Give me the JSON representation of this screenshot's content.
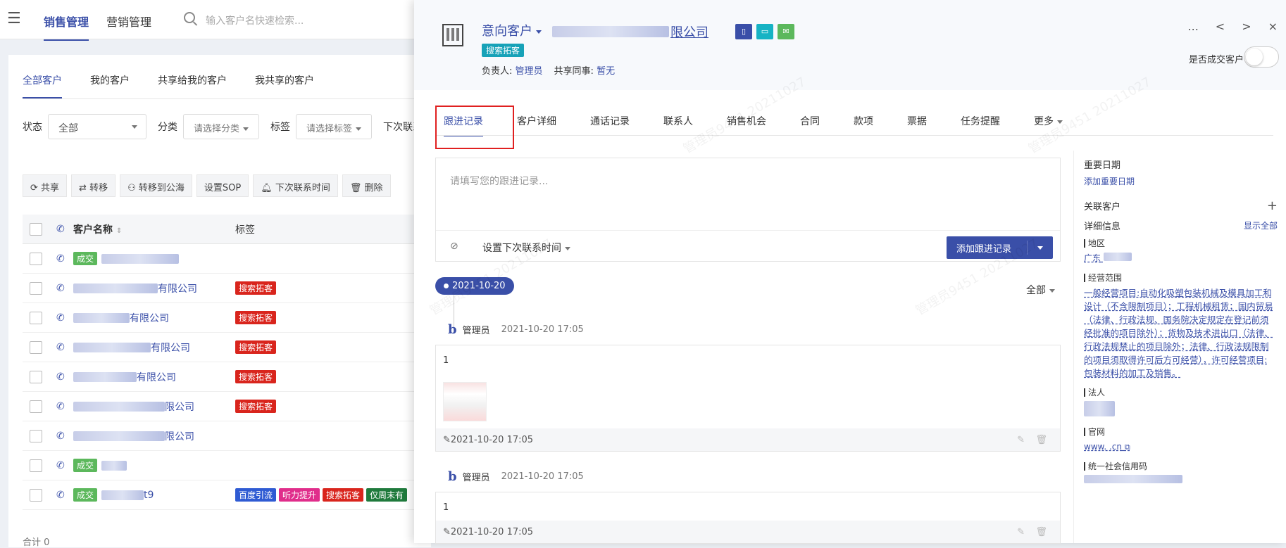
{
  "topbar": {
    "nav_sales": "销售管理",
    "nav_marketing": "营销管理",
    "search_placeholder": "输入客户名快速检索..."
  },
  "customer_tabs": [
    "全部客户",
    "我的客户",
    "共享给我的客户",
    "我共享的客户"
  ],
  "filters": {
    "status_label": "状态",
    "status_value": "全部",
    "category_label": "分类",
    "category_value": "请选择分类",
    "tag_label": "标签",
    "tag_value": "请选择标签",
    "next_contact_label": "下次联系"
  },
  "actions": [
    "共享",
    "转移",
    "转移到公海",
    "设置SOP",
    "下次联系时间",
    "删除"
  ],
  "table": {
    "headers": {
      "name": "客户名称",
      "tags": "标签"
    },
    "rows": [
      {
        "badge": "成交",
        "name_suffix": "",
        "tags": []
      },
      {
        "badge": "",
        "name_suffix": "有限公司",
        "tags": [
          "搜索拓客"
        ]
      },
      {
        "badge": "",
        "name_suffix": "有限公司",
        "tags": [
          "搜索拓客"
        ]
      },
      {
        "badge": "",
        "name_suffix": "有限公司",
        "tags": [
          "搜索拓客"
        ]
      },
      {
        "badge": "",
        "name_suffix": "有限公司",
        "tags": [
          "搜索拓客"
        ]
      },
      {
        "badge": "",
        "name_suffix": "限公司",
        "tags": [
          "搜索拓客"
        ]
      },
      {
        "badge": "",
        "name_suffix": "限公司",
        "tags": []
      },
      {
        "badge": "成交",
        "name_suffix": "",
        "tags": []
      },
      {
        "badge": "成交",
        "name_suffix": "t9",
        "tags": [
          "百度引流",
          "听力提升",
          "搜索拓客",
          "仅周末有"
        ]
      }
    ],
    "footer": "合计 0"
  },
  "tag_colors": {
    "搜索拓客": "#d9251d",
    "百度引流": "#2f5bd3",
    "听力提升": "#e02d8b",
    "仅周末有": "#1f7a3c",
    "成交": "#5cb85c"
  },
  "detail": {
    "status": "意向客户",
    "company_suffix": "限公司",
    "source_tag": "搜索拓客",
    "owner_label": "负责人:",
    "owner_value": "管理员",
    "share_label": "共享同事:",
    "share_value": "暂无",
    "header_controls": [
      "...",
      "<",
      ">",
      "×"
    ],
    "deal_label": "是否成交客户",
    "deal_toggle_on": false,
    "tabs": [
      "跟进记录",
      "客户详细",
      "通话记录",
      "联系人",
      "销售机会",
      "合同",
      "款项",
      "票据",
      "任务提醒",
      "更多"
    ],
    "editor_placeholder": "请填写您的跟进记录...",
    "set_next_time": "设置下次联系时间",
    "add_button": "添加跟进记录",
    "date_pill": "2021-10-20",
    "filter_all": "全部",
    "entries": [
      {
        "author": "管理员",
        "time": "2021-10-20 17:05",
        "content": "1",
        "footer_time": "2021-10-20 17:05"
      },
      {
        "author": "管理员",
        "time": "2021-10-20 17:05",
        "content": "1",
        "footer_time": "2021-10-20 17:05"
      }
    ],
    "sidebar": {
      "important_date": "重要日期",
      "add_important_date": "添加重要日期",
      "related_customer": "关联客户",
      "detail_info": "详细信息",
      "show_all": "显示全部",
      "region_label": "地区",
      "region_value": "广东",
      "scope_label": "经营范围",
      "scope_value": "一般经营项目:自动化吸塑包装机械及模具加工和设计（不含限制项目）；工程机械租赁；国内贸易（法律、行政法规、国务院决定规定在登记前须经批准的项目除外）；货物及技术进出口（法律、行政法规禁止的项目除外；法律、行政法规限制的项目须取得许可后方可经营），许可经营项目:包装材料的加工及销售。",
      "legal_label": "法人",
      "website_label": "官网",
      "website_value": "www.            .cn",
      "credit_label": "统一社会信用码"
    }
  }
}
